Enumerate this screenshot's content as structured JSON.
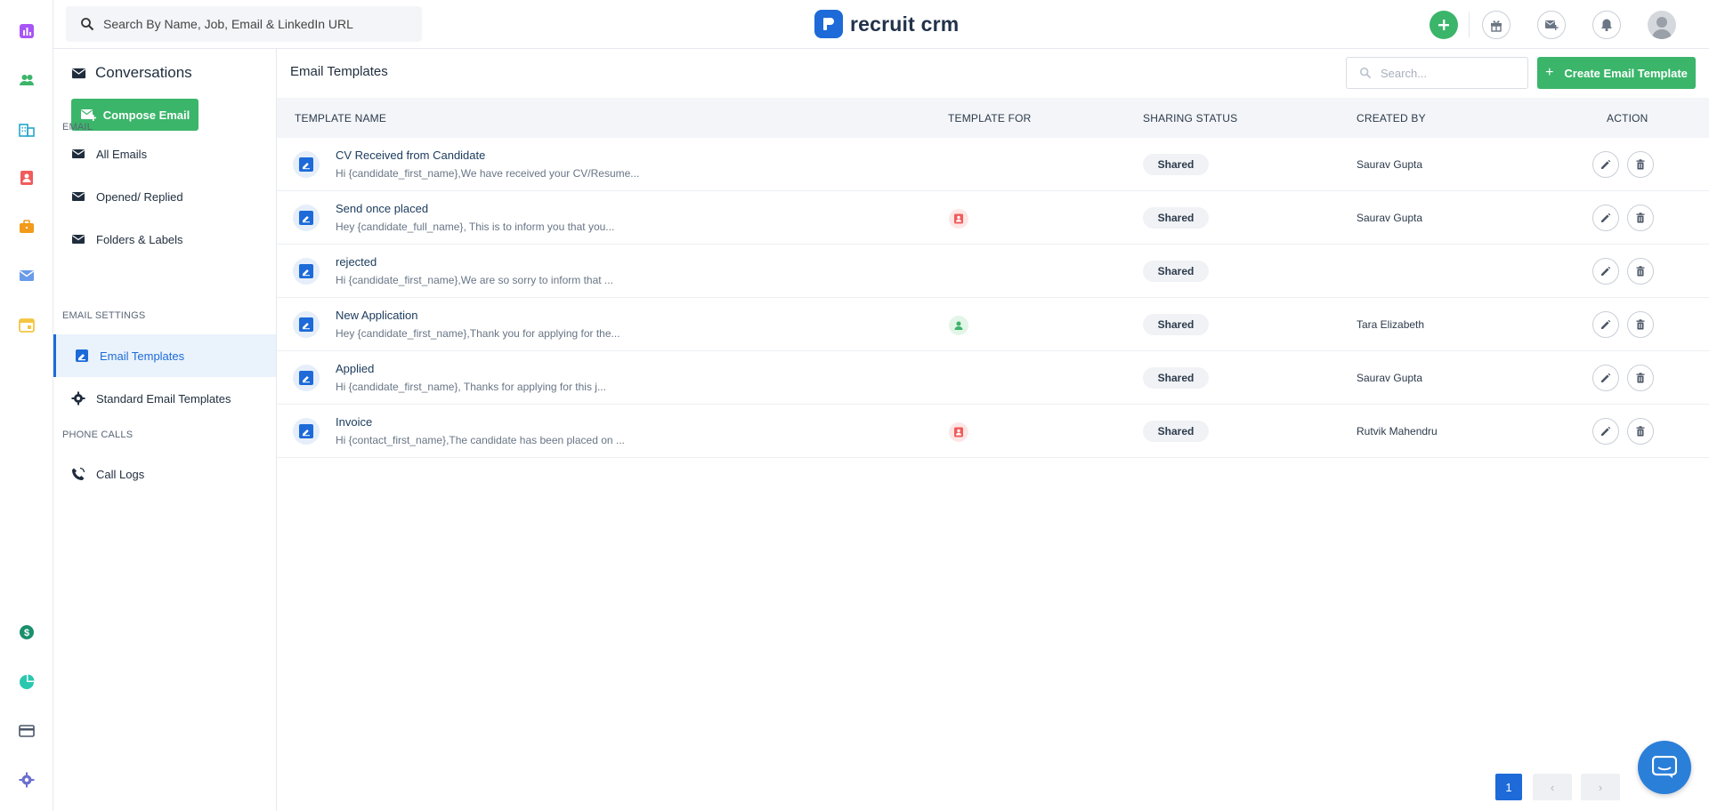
{
  "rail": {
    "items": [
      {
        "icon": "reports-icon",
        "color": "#a855f7"
      },
      {
        "icon": "candidates-icon",
        "color": "#3bb56a"
      },
      {
        "icon": "companies-icon",
        "color": "#26a6c9"
      },
      {
        "icon": "contacts-icon",
        "color": "#f25b5b"
      },
      {
        "icon": "jobs-icon",
        "color": "#f29a1b"
      },
      {
        "icon": "email-icon",
        "color": "#6a9bea"
      },
      {
        "icon": "calendar-icon",
        "color": "#f5c542"
      },
      {
        "icon": "billing-icon",
        "color": "#1a8f6c"
      },
      {
        "icon": "analytics-icon",
        "color": "#2bc8b0"
      },
      {
        "icon": "card-icon",
        "color": "#4a5566"
      },
      {
        "icon": "settings-icon",
        "color": "#6b6fcf"
      }
    ]
  },
  "topbar": {
    "search_placeholder": "Search By Name, Job, Email & LinkedIn URL",
    "logo_text": "recruit crm",
    "brand_color": "#1d6ad8",
    "accent_green": "#3bb56a"
  },
  "sidebar": {
    "title": "Conversations",
    "compose_label": "Compose Email",
    "email_section": "EMAIL",
    "email_items": [
      "All Emails",
      "Opened/ Replied",
      "Folders & Labels"
    ],
    "settings_section": "EMAIL SETTINGS",
    "settings_items": [
      "Email Templates",
      "Standard Email Templates"
    ],
    "phone_section": "PHONE CALLS",
    "phone_items": [
      "Call Logs"
    ]
  },
  "main": {
    "title": "Email Templates",
    "search_placeholder": "Search...",
    "create_label": "Create Email Template",
    "columns": [
      "TEMPLATE NAME",
      "TEMPLATE FOR",
      "SHARING STATUS",
      "CREATED BY",
      "ACTION"
    ],
    "rows": [
      {
        "name": "CV Received from Candidate",
        "preview": "Hi {candidate_first_name},We have received your CV/Resume...",
        "template_for": "",
        "status": "Shared",
        "created_by": "Saurav Gupta"
      },
      {
        "name": "Send once placed",
        "preview": "Hey {candidate_full_name}, This is to inform you that you...",
        "template_for": "contact",
        "status": "Shared",
        "created_by": "Saurav Gupta"
      },
      {
        "name": "rejected",
        "preview": "Hi {candidate_first_name},We are so sorry to inform that ...",
        "template_for": "",
        "status": "Shared",
        "created_by": ""
      },
      {
        "name": "New Application",
        "preview": "Hey {candidate_first_name},Thank you for applying for the...",
        "template_for": "candidate",
        "status": "Shared",
        "created_by": "Tara Elizabeth"
      },
      {
        "name": "Applied",
        "preview": "Hi {candidate_first_name}, Thanks for applying for this j...",
        "template_for": "",
        "status": "Shared",
        "created_by": "Saurav Gupta"
      },
      {
        "name": "Invoice",
        "preview": "Hi {contact_first_name},The candidate has been placed on ...",
        "template_for": "contact",
        "status": "Shared",
        "created_by": "Rutvik Mahendru"
      }
    ],
    "pagination": {
      "current": "1",
      "prev": "‹",
      "next": "›"
    }
  }
}
